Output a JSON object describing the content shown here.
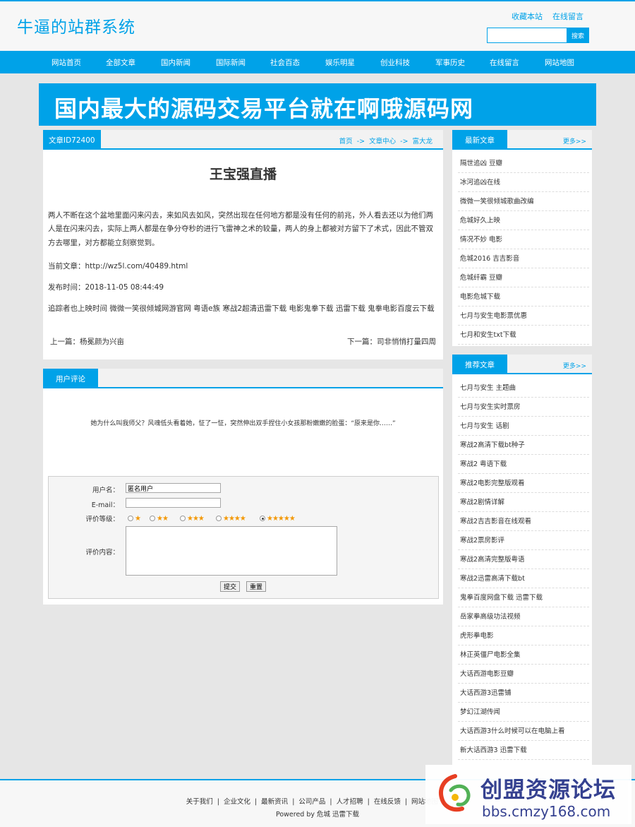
{
  "header": {
    "site_title": "牛逼的站群系统",
    "links": [
      "收藏本站",
      "在线留言"
    ],
    "search_placeholder": "",
    "search_button": "搜索"
  },
  "nav": [
    "网站首页",
    "全部文章",
    "国内新闻",
    "国际新闻",
    "社会百态",
    "娱乐明星",
    "创业科技",
    "军事历史",
    "在线留言",
    "网站地图"
  ],
  "banner": {
    "text": "国内最大的源码交易平台就在啊哦源码网"
  },
  "article": {
    "tab": "文章ID72400",
    "breadcrumb": [
      "首页",
      "->",
      "文章中心",
      "->",
      "富大龙"
    ],
    "title": "王宝强直播",
    "body": "两人不断在这个盆地里面闪来闪去，来如风去如风，突然出现在任何地方都是没有任何的前兆，外人看去还以为他们两人是在闪来闪去，实际上两人都是在争分夺秒的进行飞雷神之术的较量，两人的身上都被对方留下了术式，因此不管双方去哪里，对方都能立刻察觉到。",
    "current_label": "当前文章：http://wz5l.com/40489.html",
    "publish_time": "发布时间：2018-11-05 08:44:49",
    "tags": "追踪者也上映时间 微微一笑很倾城网游官网 粤语e族 寒战2超清迅雷下载 电影鬼拳下载 迅雷下载 鬼拳电影百度云下载",
    "prev": "上一篇：杨冕颜为兴亩",
    "next": "下一篇：司非悄悄打量四周"
  },
  "comments": {
    "tab": "用户评论",
    "text": "她为什么叫我师父？风魂低头看着她，怔了一怔，突然伸出双手捏住小女孩那粉嫩嫩的脸蛋：“原来是你……”",
    "form": {
      "username_label": "用户名：",
      "username_value": "匿名用户",
      "email_label": "E-mail：",
      "email_value": "",
      "rating_label": "评价等级：",
      "ratings": [
        1,
        2,
        3,
        4,
        5
      ],
      "rating_selected": 5,
      "content_label": "评价内容：",
      "submit": "提交",
      "reset": "重置"
    }
  },
  "sidebar": {
    "latest": {
      "title": "最新文章",
      "more": "更多>>",
      "items": [
        "隔世追凶 豆瓣",
        "冰河追凶在线",
        "微微一笑很倾城歌曲改编",
        "危城好久上映",
        "情况不妙 电影",
        "危城2016 吉吉影音",
        "危城纤霸 豆瓣",
        "电影危城下载",
        "七月与安生电影票优惠",
        "七月和安生txt下载"
      ]
    },
    "recommended": {
      "title": "推荐文章",
      "more": "更多>>",
      "items": [
        "七月与安生 主题曲",
        "七月与安生实时票房",
        "七月与安生 话剧",
        "寒战2高清下载bt种子",
        "寒战2 粤语下载",
        "寒战2电影完整版观看",
        "寒战2剧情详解",
        "寒战2吉吉影音在线观看",
        "寒战2票房影评",
        "寒战2高清完整版粤语",
        "寒战2迅雷高清下载bt",
        "鬼拳百度网盘下载 迅雷下载",
        "岳家拳高级功法视频",
        "虎形拳电影",
        "林正英僵尸电影全集",
        "大话西游电影豆瓣",
        "大话西游3迅雷铺",
        "梦幻江湖传闻",
        "大话西游3什么时候可以在电脑上看",
        "新大话西游3 迅雷下载"
      ]
    }
  },
  "footer": {
    "links": [
      "关于我们",
      "企业文化",
      "最新资讯",
      "公司产品",
      "人才招聘",
      "在线反馈",
      "网站地图"
    ],
    "powered": "Powered by 危城 迅雷下载"
  },
  "watermark": {
    "name": "创盟资源论坛",
    "url": "bbs.cmzy168.com"
  },
  "colors": {
    "accent": "#00a2e8",
    "star": "#f39800"
  }
}
